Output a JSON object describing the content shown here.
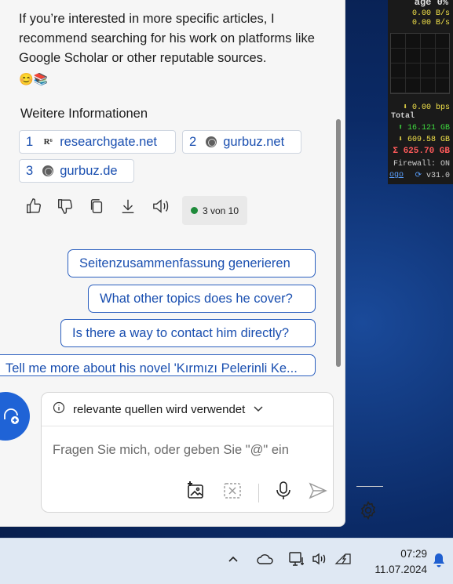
{
  "chat": {
    "message": "If you’re interested in more specific articles, I recommend searching for his work on platforms like Google Scholar or other reputable sources.",
    "emoji": "😊📚"
  },
  "sources": {
    "title": "Weitere Informationen",
    "items": [
      {
        "num": "1",
        "favicon": "R⁶",
        "label": "researchgate.net"
      },
      {
        "num": "2",
        "favicon": "globe-icon",
        "label": "gurbuz.net"
      },
      {
        "num": "3",
        "favicon": "globe-icon",
        "label": "gurbuz.de"
      }
    ]
  },
  "response_counter": "3 von 10",
  "suggestions": [
    "Seitenzusammenfassung generieren",
    "What other topics does he cover?",
    "Is there a way to contact him directly?",
    "Tell me more about his novel 'Kırmızı Pelerinli Ke..."
  ],
  "composer": {
    "header": "relevante quellen wird verwendet",
    "placeholder": "Fragen Sie mich, oder geben Sie \"@\" ein"
  },
  "meter": {
    "top": "age      0%",
    "up_rate": "0.00 B/s",
    "down_rate": "0.00 B/s",
    "bps": "0.00 bps",
    "total_label": "Total",
    "total_up": "16.121 GB",
    "total_down": "609.58 GB",
    "sum": "625.70 GB",
    "firewall": "Firewall: ON",
    "logo": "ogo",
    "version": "v31.0"
  },
  "taskbar": {
    "time": "07:29",
    "date": "11.07.2024"
  },
  "colors": {
    "accent": "#1a4fb0",
    "panel_bg": "#f6f6f6",
    "avatar": "#1f63d6",
    "taskbar": "#dfe8f3"
  }
}
